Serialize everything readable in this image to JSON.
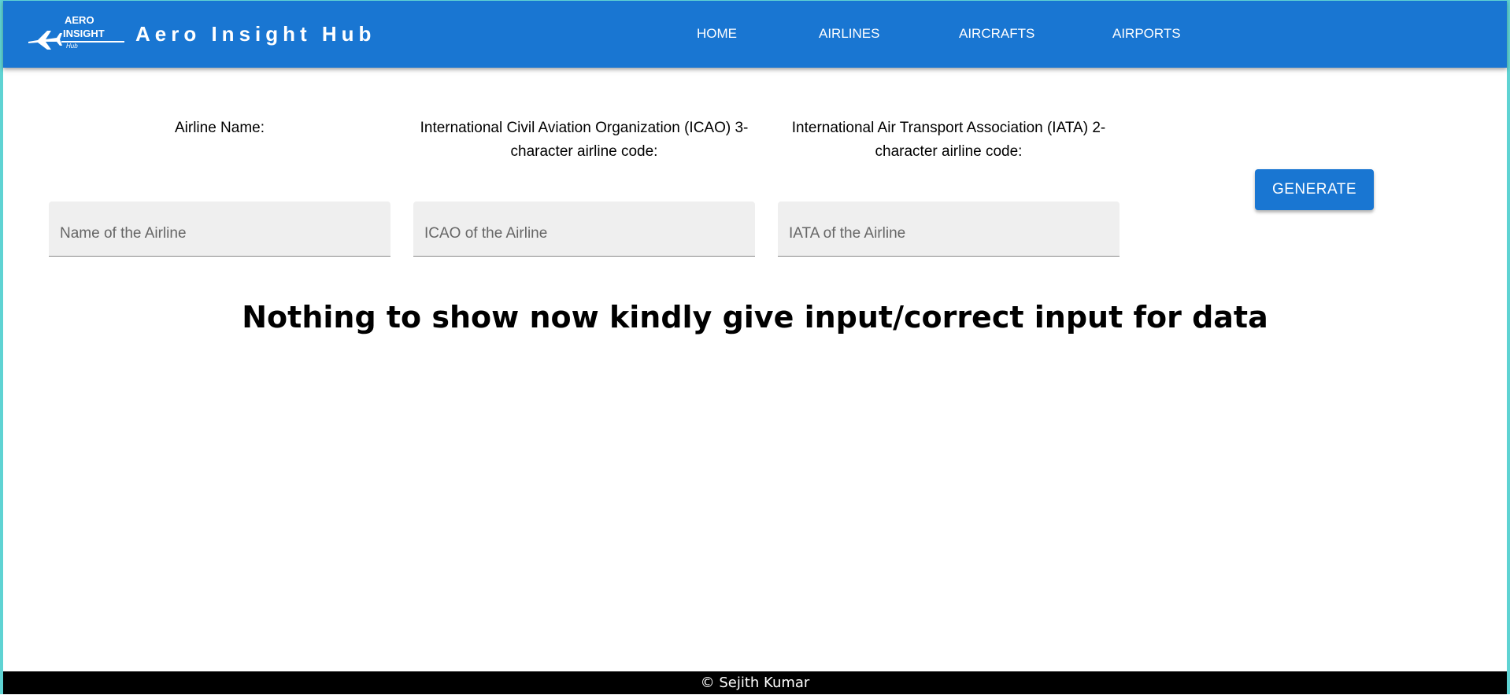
{
  "header": {
    "logo": {
      "line1": "AERO",
      "line2": "INSIGHT",
      "line3": "Hub",
      "icon": "airplane-icon"
    },
    "brand_title": "Aero Insight Hub",
    "nav": {
      "home": "HOME",
      "airlines": "AIRLINES",
      "aircrafts": "AIRCRAFTS",
      "airports": "AIRPORTS"
    }
  },
  "form": {
    "name": {
      "label": "Airline Name:",
      "placeholder": "Name of the Airline",
      "value": ""
    },
    "icao": {
      "label": "International Civil Aviation Organization (ICAO) 3-character airline code:",
      "placeholder": "ICAO of the Airline",
      "value": ""
    },
    "iata": {
      "label": "International Air Transport Association (IATA) 2-character airline code:",
      "placeholder": "IATA of the Airline",
      "value": ""
    },
    "generate_label": "GENERATE"
  },
  "main": {
    "empty_message": "Nothing to show now kindly give input/correct input for data"
  },
  "footer": {
    "text": "© Sejith Kumar"
  },
  "colors": {
    "primary": "#1976d2",
    "frame_accent": "#5fd3d3",
    "input_bg": "#efefef",
    "footer_bg": "#000000"
  }
}
